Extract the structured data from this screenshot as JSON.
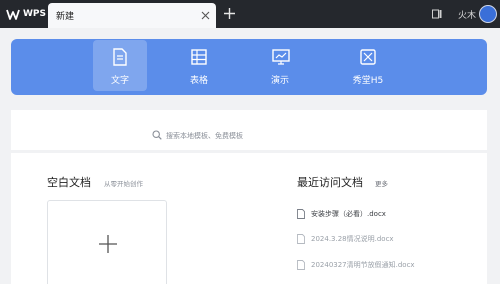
{
  "app": {
    "name": "WPS"
  },
  "titlebar": {
    "tab_label": "新建",
    "user_name": "火木"
  },
  "categories": [
    {
      "id": "text",
      "label": "文字",
      "icon": "document-icon",
      "active": true
    },
    {
      "id": "sheet",
      "label": "表格",
      "icon": "table-icon",
      "active": false
    },
    {
      "id": "present",
      "label": "演示",
      "icon": "presentation-icon",
      "active": false
    },
    {
      "id": "h5",
      "label": "秀堂H5",
      "icon": "h5-icon",
      "active": false
    }
  ],
  "search": {
    "placeholder": "搜索本地模板、免费模板"
  },
  "blank": {
    "title": "空白文档",
    "subtitle": "从零开始创作"
  },
  "recent": {
    "title": "最近访问文档",
    "more_label": "更多",
    "items": [
      {
        "name": "安装步骤（必看）.docx"
      },
      {
        "name": "2024.3.28情况说明.docx"
      },
      {
        "name": "20240327清明节放假通知.docx"
      }
    ]
  },
  "colors": {
    "titlebar": "#25282d",
    "banner": "#5b8dea",
    "background": "#f1f2f4"
  }
}
